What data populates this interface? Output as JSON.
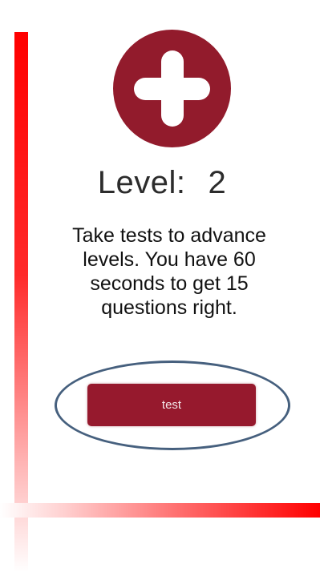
{
  "level": {
    "label": "Level:",
    "value": "2"
  },
  "description": "Take tests to advance levels. You have 60 seconds to get 15 questions right.",
  "test_button": {
    "label": "test"
  },
  "icons": {
    "badge": "plus-icon"
  },
  "colors": {
    "badge": "#921b2c",
    "button": "#96192d",
    "highlight_oval": "#46607e",
    "gradient_bars": "#ff0000"
  }
}
